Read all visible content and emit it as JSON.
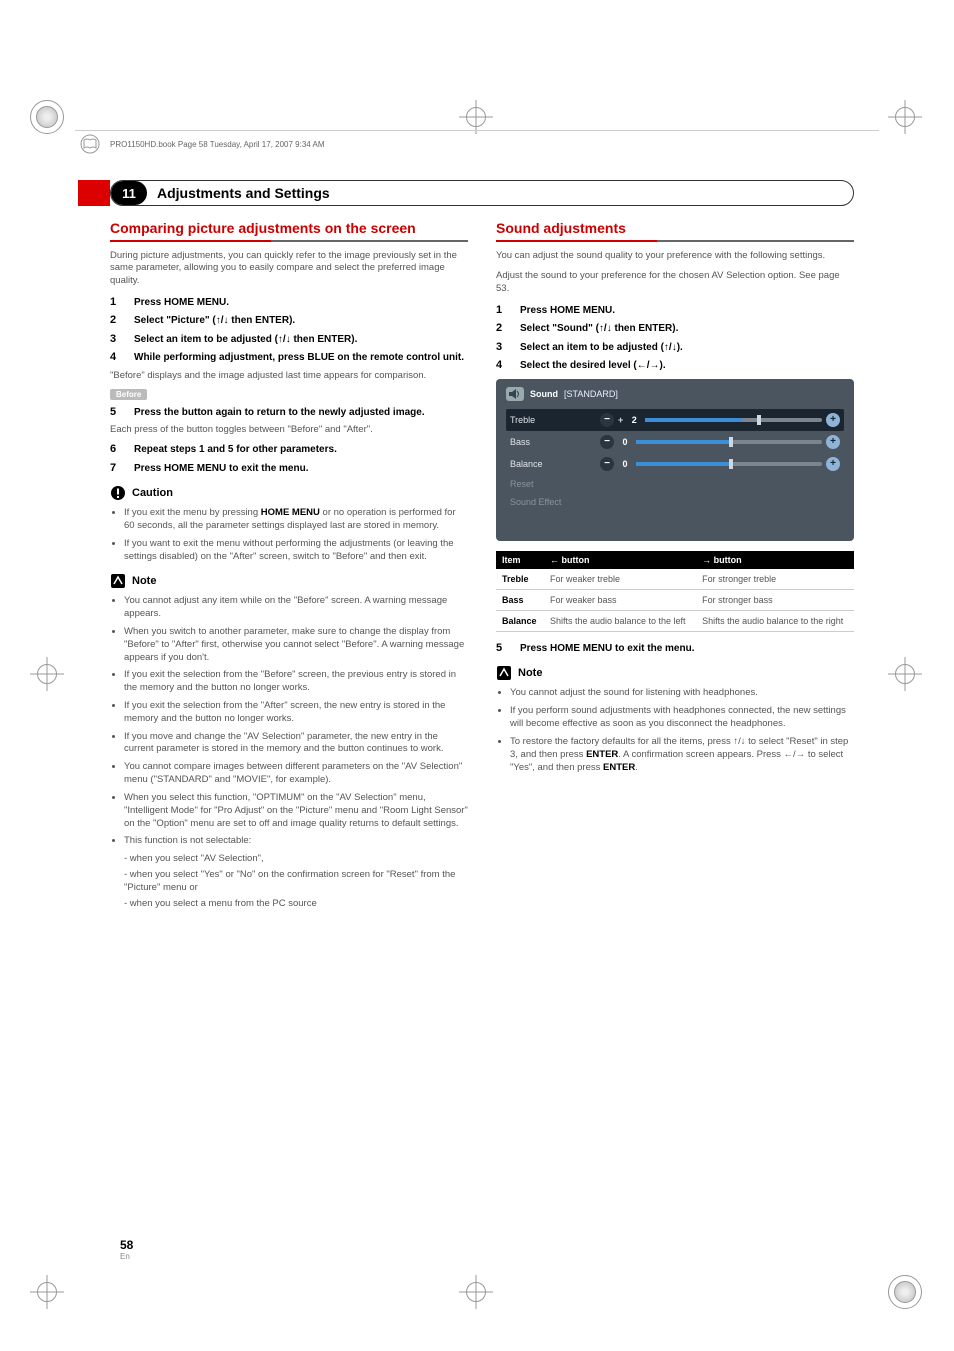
{
  "header": {
    "running_text": "PRO1150HD.book  Page 58  Tuesday, April 17, 2007  9:34 AM"
  },
  "chapter": {
    "number": "11",
    "title": "Adjustments and Settings"
  },
  "left": {
    "section_title": "Comparing picture adjustments on the screen",
    "intro": "During picture adjustments, you can quickly refer to the image previously set in the same parameter, allowing you to easily compare and select the preferred image quality.",
    "steps_a": [
      {
        "n": "1",
        "t": "Press HOME MENU."
      },
      {
        "n": "2",
        "t": "Select \"Picture\" (↑/↓ then ENTER)."
      },
      {
        "n": "3",
        "t": "Select an item to be adjusted (↑/↓ then ENTER)."
      },
      {
        "n": "4",
        "t": "While performing adjustment, press BLUE on the remote control unit."
      }
    ],
    "between_a": "\"Before\" displays and the image adjusted last time appears for comparison.",
    "badge": "Before",
    "steps_b": [
      {
        "n": "5",
        "t": "Press the button again to return to the newly adjusted image."
      }
    ],
    "between_b": "Each press of the button toggles between \"Before\" and \"After\".",
    "steps_c": [
      {
        "n": "6",
        "t": "Repeat steps 1 and 5 for other parameters."
      },
      {
        "n": "7",
        "t": "Press HOME MENU to exit the menu."
      }
    ],
    "caution_title": "Caution",
    "caution_items": [
      "If you exit the menu by pressing HOME MENU or no operation is performed for 60 seconds, all the parameter settings displayed last are stored in memory.",
      "If you want to exit the menu without performing the adjustments (or leaving the settings disabled) on the \"After\" screen, switch to \"Before\" and then exit."
    ],
    "note_title": "Note",
    "note_items": [
      "You cannot adjust any item while on the \"Before\" screen. A warning message appears.",
      "When you switch to another parameter, make sure to change the display from \"Before\" to \"After\" first, otherwise you cannot select \"Before\". A warning message appears if you don't.",
      "If you exit the selection from the \"Before\" screen, the previous entry is stored in the memory and the button no longer works.",
      "If you exit the selection from the \"After\" screen, the new entry is stored in the memory and the button no longer works.",
      "If you move and change the \"AV Selection\" parameter, the new entry in the current parameter is stored in the memory and the button continues to work.",
      "You cannot compare images between different parameters on the \"AV Selection\" menu (\"STANDARD\" and \"MOVIE\", for example).",
      "When you select this function, \"OPTIMUM\" on the \"AV Selection\" menu, \"Intelligent Mode\" for \"Pro Adjust\" on the \"Picture\" menu and \"Room Light Sensor\" on the \"Option\" menu are set to off and image quality returns to default settings.",
      "This function is not selectable:"
    ],
    "sub_items": [
      "- when you select \"AV Selection\",",
      "- when you select \"Yes\" or \"No\" on the confirmation screen for \"Reset\" from the \"Picture\" menu or",
      "- when you select a menu from the PC source"
    ]
  },
  "right": {
    "section_title": "Sound adjustments",
    "intro": "You can adjust the sound quality to your preference with the following settings.",
    "intro2": "Adjust the sound to your preference for the chosen AV Selection option. See page 53.",
    "steps": [
      {
        "n": "1",
        "t": "Press HOME MENU."
      },
      {
        "n": "2",
        "t": "Select \"Sound\" (↑/↓ then ENTER)."
      },
      {
        "n": "3",
        "t": "Select an item to be adjusted (↑/↓)."
      },
      {
        "n": "4",
        "t": "Select the desired level (←/→)."
      }
    ],
    "osd": {
      "menu_title": "Sound",
      "mode": "[STANDARD]",
      "rows": [
        {
          "label": "Treble",
          "value": "2",
          "plus": "+",
          "selected": true,
          "fillPercent": 55,
          "knobPercent": 63
        },
        {
          "label": "Bass",
          "value": "0",
          "selected": false,
          "fillPercent": 50,
          "knobPercent": 50
        },
        {
          "label": "Balance",
          "value": "0",
          "selected": false,
          "fillPercent": 50,
          "knobPercent": 50
        },
        {
          "label": "Reset",
          "dim": true
        },
        {
          "label": "Sound Effect",
          "dim": true
        }
      ]
    },
    "table": {
      "headers": [
        "Item",
        "← button",
        "→ button"
      ],
      "rows": [
        [
          "Treble",
          "For weaker treble",
          "For stronger treble"
        ],
        [
          "Bass",
          "For weaker bass",
          "For stronger bass"
        ],
        [
          "Balance",
          "Shifts the audio balance to the left",
          "Shifts the audio balance to the right"
        ]
      ]
    },
    "step5": {
      "n": "5",
      "t": "Press HOME MENU to exit the menu."
    },
    "note_title": "Note",
    "note_items": [
      "You cannot adjust the sound for listening with headphones.",
      "If you perform sound adjustments with headphones connected, the new settings will become effective as soon as you disconnect the headphones.",
      "To restore the factory defaults for all the items, press ↑/↓ to select \"Reset\" in step 3, and then press ENTER. A confirmation screen appears. Press ←/→ to select \"Yes\", and then press ENTER."
    ]
  },
  "footer": {
    "page_number": "58",
    "lang": "En"
  }
}
